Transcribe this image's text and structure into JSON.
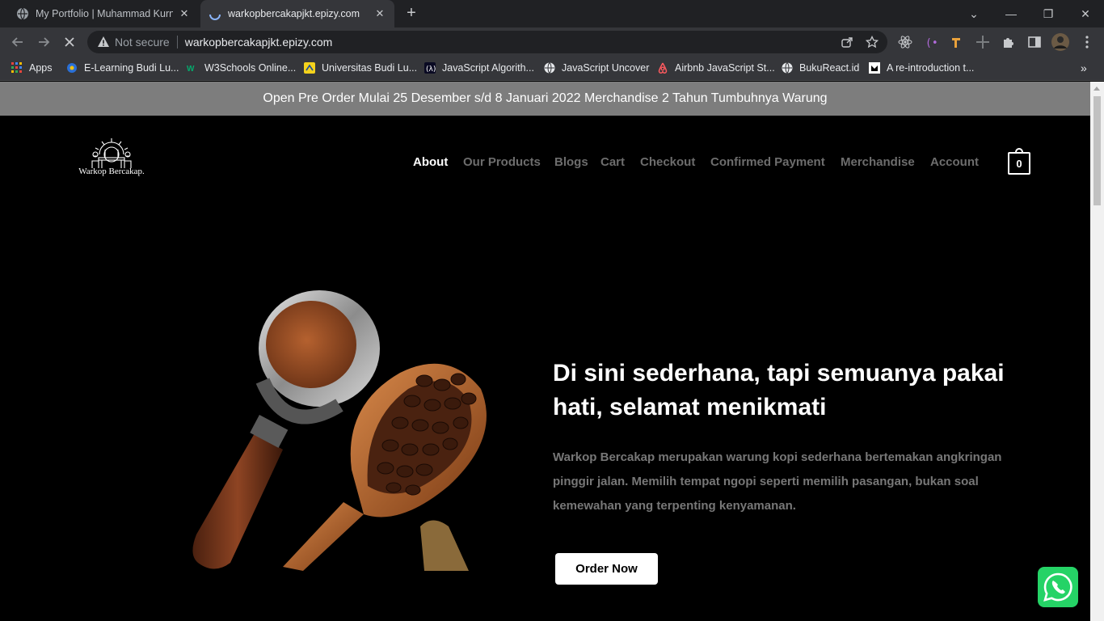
{
  "browser": {
    "tabs": [
      {
        "title": "My Portfolio | Muhammad Kurnia",
        "active": false
      },
      {
        "title": "warkopbercakapjkt.epizy.com",
        "active": true
      }
    ],
    "omnibox": {
      "security_label": "Not secure",
      "url": "warkopbercakapjkt.epizy.com"
    },
    "bookmarks": [
      {
        "label": "Apps",
        "icon": "apps-grid-icon"
      },
      {
        "label": "E-Learning Budi Lu...",
        "icon": "elearning-icon"
      },
      {
        "label": "W3Schools Online...",
        "icon": "w3schools-icon"
      },
      {
        "label": "Universitas Budi Lu...",
        "icon": "university-icon"
      },
      {
        "label": "JavaScript Algorith...",
        "icon": "js-algorithm-icon"
      },
      {
        "label": "JavaScript Uncover",
        "icon": "globe-icon"
      },
      {
        "label": "Airbnb JavaScript St...",
        "icon": "airbnb-icon"
      },
      {
        "label": "BukuReact.id",
        "icon": "globe-icon"
      },
      {
        "label": "A re-introduction t...",
        "icon": "mdn-icon"
      }
    ],
    "bookmarks_overflow": "»"
  },
  "site": {
    "announcement": "Open Pre Order Mulai 25 Desember s/d 8 Januari 2022 Merchandise 2 Tahun Tumbuhnya Warung",
    "logo_text": "Warkop Bercakap.",
    "nav": [
      {
        "label": "About",
        "active": true
      },
      {
        "label": "Our Products",
        "active": false
      },
      {
        "label": "Blogs",
        "active": false
      },
      {
        "label": "Cart",
        "active": false
      },
      {
        "label": "Checkout",
        "active": false
      },
      {
        "label": "Confirmed Payment",
        "active": false
      },
      {
        "label": "Merchandise",
        "active": false
      },
      {
        "label": "Account",
        "active": false
      }
    ],
    "cart_count": "0",
    "hero": {
      "headline": "Di sini sederhana, tapi semuanya pakai hati, selamat menikmati",
      "description": "Warkop Bercakap merupakan warung kopi sederhana bertemakan angkringan pinggir jalan. Memilih tempat ngopi seperti memilih pasangan, bukan soal kemewahan yang terpenting kenyamanan.",
      "cta": "Order Now"
    }
  },
  "colors": {
    "announcement_bg": "#7d7d7d",
    "nav_inactive": "#6d6d6d",
    "whatsapp": "#25d366"
  }
}
